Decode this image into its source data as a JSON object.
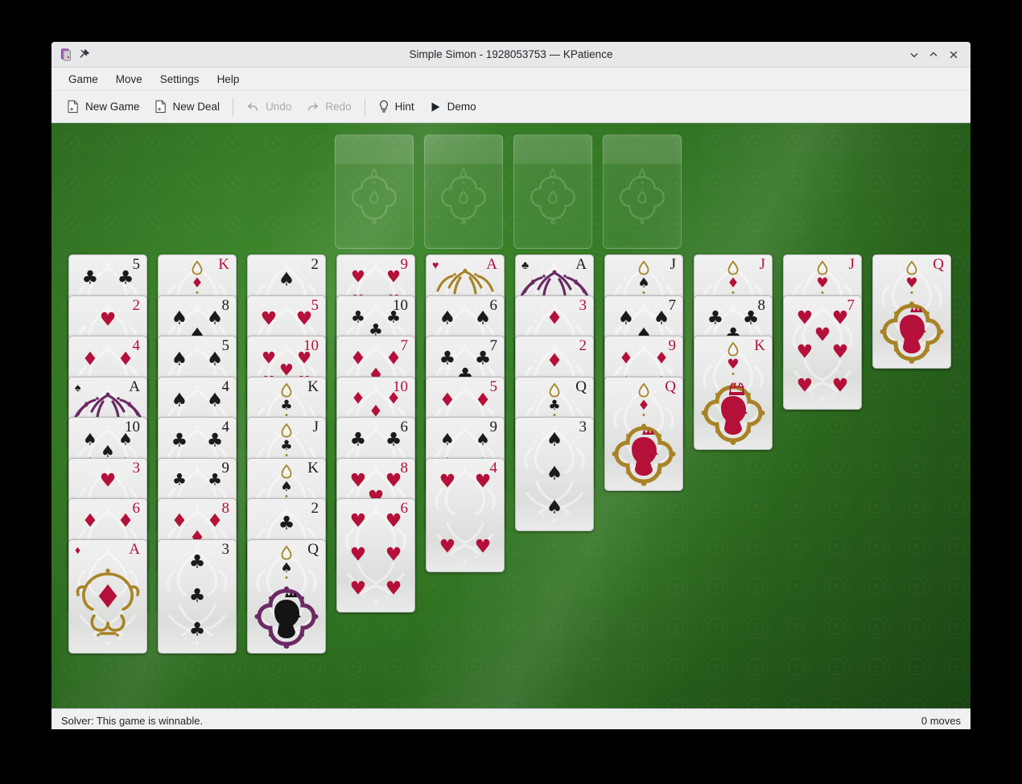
{
  "window": {
    "title": "Simple Simon - 1928053753 — KPatience",
    "controls": {
      "minimize": "minimize-window",
      "maximize": "maximize-window",
      "close": "close-window"
    }
  },
  "menubar": {
    "items": [
      "Game",
      "Move",
      "Settings",
      "Help"
    ]
  },
  "toolbar": {
    "buttons": [
      {
        "label": "New Game",
        "icon": "new-document-icon",
        "enabled": true
      },
      {
        "label": "New Deal",
        "icon": "new-document-icon",
        "enabled": true
      },
      {
        "label": "Undo",
        "icon": "undo-arrow-icon",
        "enabled": false
      },
      {
        "label": "Redo",
        "icon": "redo-arrow-icon",
        "enabled": false
      },
      {
        "label": "Hint",
        "icon": "lightbulb-icon",
        "enabled": true
      },
      {
        "label": "Demo",
        "icon": "play-triangle-icon",
        "enabled": true
      }
    ]
  },
  "statusbar": {
    "solver": "Solver: This game is winnable.",
    "moves": "0 moves"
  },
  "board": {
    "felt_color": "#2f7220",
    "foundations": [
      {
        "name": "foundation-slot-1",
        "empty": true
      },
      {
        "name": "foundation-slot-2",
        "empty": true
      },
      {
        "name": "foundation-slot-3",
        "empty": true
      },
      {
        "name": "foundation-slot-4",
        "empty": true
      }
    ],
    "card_colors": {
      "red": "#b4103a",
      "black": "#1b1b1b",
      "gold": "#a88326",
      "purple": "#6b2a63"
    },
    "columns": [
      {
        "name": "tableau-column-1",
        "cards": [
          {
            "rank": "5",
            "suit": "clubs"
          },
          {
            "rank": "2",
            "suit": "hearts"
          },
          {
            "rank": "4",
            "suit": "diamonds"
          },
          {
            "rank": "A",
            "suit": "spades"
          },
          {
            "rank": "10",
            "suit": "spades"
          },
          {
            "rank": "3",
            "suit": "hearts"
          },
          {
            "rank": "6",
            "suit": "diamonds"
          },
          {
            "rank": "A",
            "suit": "diamonds"
          }
        ]
      },
      {
        "name": "tableau-column-2",
        "cards": [
          {
            "rank": "K",
            "suit": "diamonds"
          },
          {
            "rank": "8",
            "suit": "spades"
          },
          {
            "rank": "5",
            "suit": "spades"
          },
          {
            "rank": "4",
            "suit": "spades"
          },
          {
            "rank": "4",
            "suit": "clubs"
          },
          {
            "rank": "9",
            "suit": "clubs"
          },
          {
            "rank": "8",
            "suit": "diamonds"
          },
          {
            "rank": "3",
            "suit": "clubs"
          }
        ]
      },
      {
        "name": "tableau-column-3",
        "cards": [
          {
            "rank": "2",
            "suit": "spades"
          },
          {
            "rank": "5",
            "suit": "hearts"
          },
          {
            "rank": "10",
            "suit": "hearts"
          },
          {
            "rank": "K",
            "suit": "clubs"
          },
          {
            "rank": "J",
            "suit": "clubs"
          },
          {
            "rank": "K",
            "suit": "spades"
          },
          {
            "rank": "2",
            "suit": "clubs"
          },
          {
            "rank": "Q",
            "suit": "spades"
          }
        ]
      },
      {
        "name": "tableau-column-4",
        "cards": [
          {
            "rank": "9",
            "suit": "hearts"
          },
          {
            "rank": "10",
            "suit": "clubs"
          },
          {
            "rank": "7",
            "suit": "diamonds"
          },
          {
            "rank": "10",
            "suit": "diamonds"
          },
          {
            "rank": "6",
            "suit": "clubs"
          },
          {
            "rank": "8",
            "suit": "hearts"
          },
          {
            "rank": "6",
            "suit": "hearts"
          }
        ]
      },
      {
        "name": "tableau-column-5",
        "cards": [
          {
            "rank": "A",
            "suit": "hearts"
          },
          {
            "rank": "6",
            "suit": "spades"
          },
          {
            "rank": "7",
            "suit": "clubs"
          },
          {
            "rank": "5",
            "suit": "diamonds"
          },
          {
            "rank": "9",
            "suit": "spades"
          },
          {
            "rank": "4",
            "suit": "hearts"
          }
        ]
      },
      {
        "name": "tableau-column-6",
        "cards": [
          {
            "rank": "A",
            "suit": "clubs"
          },
          {
            "rank": "3",
            "suit": "diamonds"
          },
          {
            "rank": "2",
            "suit": "diamonds"
          },
          {
            "rank": "Q",
            "suit": "clubs"
          },
          {
            "rank": "3",
            "suit": "spades"
          }
        ]
      },
      {
        "name": "tableau-column-7",
        "cards": [
          {
            "rank": "J",
            "suit": "spades"
          },
          {
            "rank": "7",
            "suit": "spades"
          },
          {
            "rank": "9",
            "suit": "diamonds"
          },
          {
            "rank": "Q",
            "suit": "diamonds"
          }
        ]
      },
      {
        "name": "tableau-column-8",
        "cards": [
          {
            "rank": "J",
            "suit": "diamonds"
          },
          {
            "rank": "8",
            "suit": "clubs"
          },
          {
            "rank": "K",
            "suit": "hearts"
          }
        ]
      },
      {
        "name": "tableau-column-9",
        "cards": [
          {
            "rank": "J",
            "suit": "hearts"
          },
          {
            "rank": "7",
            "suit": "hearts"
          }
        ]
      },
      {
        "name": "tableau-column-10",
        "cards": [
          {
            "rank": "Q",
            "suit": "hearts"
          }
        ]
      }
    ]
  }
}
